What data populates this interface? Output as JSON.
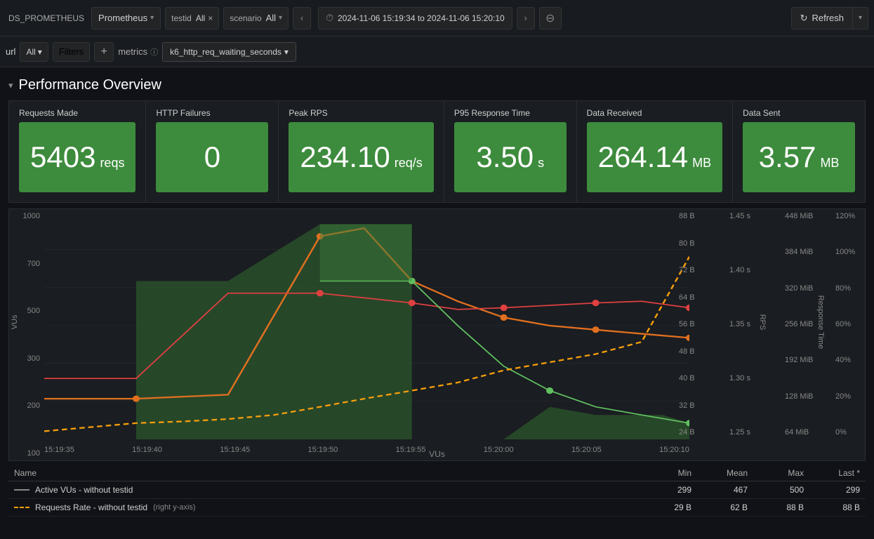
{
  "topbar": {
    "ds_label": "DS_PROMETHEUS",
    "datasource": "Prometheus",
    "testid_label": "testid",
    "testid_all": "All",
    "scenario_label": "scenario",
    "scenario_all": "All",
    "time_range": "2024-11-06 15:19:34 to 2024-11-06 15:20:10",
    "refresh_label": "Refresh",
    "clock_icon": "⏱",
    "zoom_icon": "⊖",
    "refresh_icon": "↻",
    "chevron": "▾",
    "nav_left": "‹",
    "nav_right": "›",
    "x_icon": "×"
  },
  "filterbar": {
    "url_label": "url",
    "all_label": "All",
    "filters_label": "Filters",
    "plus_label": "+",
    "metrics_label": "metrics",
    "info_icon": "ⓘ",
    "metric_value": "k6_http_req_waiting_seconds",
    "chevron": "▾"
  },
  "section": {
    "title": "Performance Overview",
    "collapse_icon": "▾"
  },
  "cards": [
    {
      "label": "Requests Made",
      "value": "5403",
      "unit": "reqs",
      "color": "#3d8b3d"
    },
    {
      "label": "HTTP Failures",
      "value": "0",
      "unit": "",
      "color": "#3d8b3d"
    },
    {
      "label": "Peak RPS",
      "value": "234.10",
      "unit": "req/s",
      "color": "#3d8b3d"
    },
    {
      "label": "P95 Response Time",
      "value": "3.50",
      "unit": "s",
      "color": "#3d8b3d"
    },
    {
      "label": "Data Received",
      "value": "264.14",
      "unit": "MB",
      "color": "#3d8b3d"
    },
    {
      "label": "Data Sent",
      "value": "3.57",
      "unit": "MB",
      "color": "#3d8b3d"
    }
  ],
  "chart": {
    "y_left_labels": [
      "1000",
      "700",
      "500",
      "300",
      "200",
      "100"
    ],
    "y_right_bytes": [
      "88 B",
      "80 B",
      "72 B",
      "64 B",
      "56 B",
      "48 B",
      "40 B",
      "32 B",
      "24 B"
    ],
    "y_right_rps": [
      "1.45 s",
      "1.40 s",
      "1.35 s",
      "1.30 s",
      "1.25 s"
    ],
    "y_right_mib": [
      "448 MiB",
      "384 MiB",
      "320 MiB",
      "256 MiB",
      "192 MiB",
      "128 MiB",
      "64 MiB"
    ],
    "y_right_pct": [
      "120%",
      "100%",
      "80%",
      "60%",
      "40%",
      "20%",
      "0%"
    ],
    "x_labels": [
      "15:19:35",
      "15:19:40",
      "15:19:45",
      "15:19:50",
      "15:19:55",
      "15:20:00",
      "15:20:05",
      "15:20:10"
    ],
    "x_axis_label": "VUs",
    "y_axis_label_vus": "VUs",
    "y_axis_label_rps": "RPS",
    "y_axis_label_resp": "Response Time"
  },
  "legend": {
    "headers": [
      "Name",
      "Min",
      "Mean",
      "Max",
      "Last *"
    ],
    "rows": [
      {
        "name": "Active VUs - without testid",
        "line_type": "solid",
        "line_color": "#888",
        "min": "299",
        "mean": "467",
        "max": "500",
        "last": "299"
      },
      {
        "name": "Requests Rate - without testid",
        "note": "(right y-axis)",
        "line_type": "dashed",
        "line_color": "#f59e0b",
        "min": "29 B",
        "mean": "62 B",
        "max": "88 B",
        "last": "88 B"
      }
    ]
  }
}
